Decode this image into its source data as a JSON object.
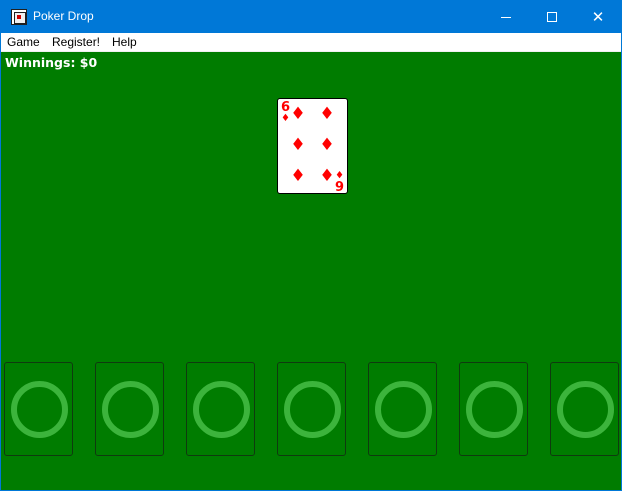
{
  "window": {
    "title": "Poker Drop",
    "app_icon": "poker-drop-app-icon",
    "controls": {
      "minimize_icon": "minimize-icon",
      "maximize_icon": "maximize-icon",
      "close_glyph": "✕"
    },
    "titlebar_color": "#0078d7"
  },
  "menubar": {
    "items": [
      {
        "label": "Game"
      },
      {
        "label": "Register!"
      },
      {
        "label": "Help"
      }
    ]
  },
  "game": {
    "felt_color": "#007c00",
    "winnings_label": "Winnings: $0",
    "falling_card": {
      "rank": "6",
      "suit": "diamonds",
      "suit_glyph": "♦",
      "color": "#ff0000"
    },
    "slots": [
      {
        "state": "empty",
        "icon": "ring-icon"
      },
      {
        "state": "empty",
        "icon": "ring-icon"
      },
      {
        "state": "empty",
        "icon": "ring-icon"
      },
      {
        "state": "empty",
        "icon": "ring-icon"
      },
      {
        "state": "empty",
        "icon": "ring-icon"
      },
      {
        "state": "empty",
        "icon": "ring-icon"
      },
      {
        "state": "empty",
        "icon": "ring-icon"
      }
    ],
    "ring_color": "#3cb43c"
  }
}
